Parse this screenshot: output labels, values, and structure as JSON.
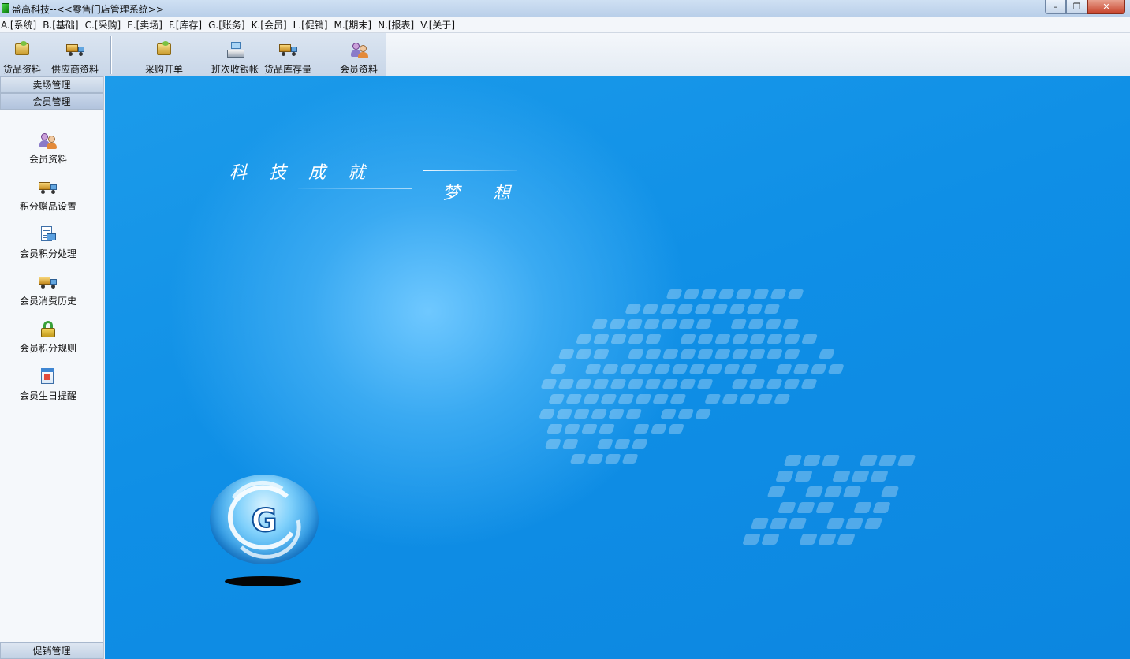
{
  "window": {
    "title": "盛高科技--<<零售门店管理系统>>",
    "minimize_icon": "minimize-icon",
    "restore_icon": "restore-icon",
    "close_icon": "close-icon"
  },
  "menu": [
    "A.[系统]",
    "B.[基础]",
    "C.[采购]",
    "E.[卖场]",
    "F.[库存]",
    "G.[账务]",
    "K.[会员]",
    "L.[促销]",
    "M.[期末]",
    "N.[报表]",
    "V.[关于]"
  ],
  "toolbar": {
    "goods": "货品资料",
    "supplier": "供应商资料",
    "purchase": "采购开单",
    "shift_cash": "班次收银帐",
    "stock": "货品库存量",
    "member": "会员资料"
  },
  "sidebar": {
    "headers": [
      "卖场管理",
      "会员管理"
    ],
    "items": [
      {
        "label": "会员资料",
        "icon": "members-icon"
      },
      {
        "label": "积分赠品设置",
        "icon": "gift-truck-icon"
      },
      {
        "label": "会员积分处理",
        "icon": "points-doc-icon"
      },
      {
        "label": "会员消费历史",
        "icon": "history-truck-icon"
      },
      {
        "label": "会员积分规则",
        "icon": "lock-icon"
      },
      {
        "label": "会员生日提醒",
        "icon": "calendar-icon"
      }
    ],
    "bottom_header": "促销管理"
  },
  "banner": {
    "slogan_line1": "科技成就",
    "slogan_line2": "梦想",
    "logo_letter": "G"
  },
  "colors": {
    "banner_blue": "#0f8fe6",
    "sidebar_bg": "#f5f8fb"
  }
}
